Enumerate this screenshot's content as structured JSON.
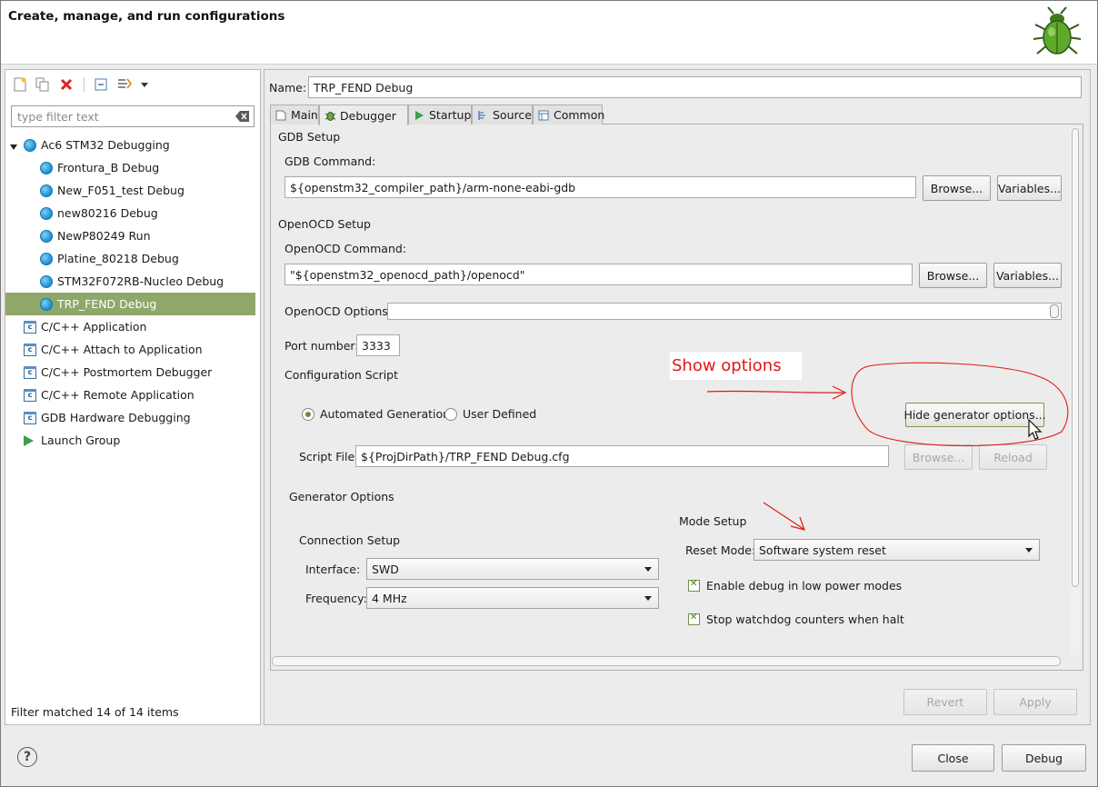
{
  "window": {
    "title": "Create, manage, and run configurations"
  },
  "sidebar": {
    "toolbar": [
      {
        "name": "new-config-icon"
      },
      {
        "name": "duplicate-icon"
      },
      {
        "name": "delete-icon"
      },
      {
        "name": "collapse-all-icon"
      },
      {
        "name": "filter-icon"
      },
      {
        "name": "dropdown-arrow-icon"
      }
    ],
    "filter_placeholder": "type filter text",
    "tree": [
      {
        "label": "Ac6 STM32 Debugging",
        "level": 0,
        "icon": "globe-icon",
        "expanded": true
      },
      {
        "label": "Frontura_B Debug",
        "level": 1,
        "icon": "globe-icon"
      },
      {
        "label": "New_F051_test Debug",
        "level": 1,
        "icon": "globe-icon"
      },
      {
        "label": "new80216 Debug",
        "level": 1,
        "icon": "globe-icon"
      },
      {
        "label": "NewP80249 Run",
        "level": 1,
        "icon": "globe-icon"
      },
      {
        "label": "Platine_80218 Debug",
        "level": 1,
        "icon": "globe-icon"
      },
      {
        "label": "STM32F072RB-Nucleo Debug",
        "level": 1,
        "icon": "globe-icon"
      },
      {
        "label": "TRP_FEND Debug",
        "level": 1,
        "icon": "globe-icon",
        "selected": true
      },
      {
        "label": "C/C++ Application",
        "level": 0,
        "icon": "c-app-icon"
      },
      {
        "label": "C/C++ Attach to Application",
        "level": 0,
        "icon": "c-app-icon"
      },
      {
        "label": "C/C++ Postmortem Debugger",
        "level": 0,
        "icon": "c-app-icon"
      },
      {
        "label": "C/C++ Remote Application",
        "level": 0,
        "icon": "c-app-icon"
      },
      {
        "label": "GDB Hardware Debugging",
        "level": 0,
        "icon": "c-app-icon"
      },
      {
        "label": "Launch Group",
        "level": 0,
        "icon": "launch-icon"
      }
    ],
    "status": "Filter matched 14 of 14 items"
  },
  "main": {
    "name_label": "Name:",
    "name_value": "TRP_FEND Debug",
    "tabs": [
      {
        "label": "Main",
        "icon": "main-tab-icon"
      },
      {
        "label": "Debugger",
        "icon": "debugger-tab-icon",
        "active": true
      },
      {
        "label": "Startup",
        "icon": "startup-tab-icon"
      },
      {
        "label": "Source",
        "icon": "source-tab-icon"
      },
      {
        "label": "Common",
        "icon": "common-tab-icon"
      }
    ],
    "gdb": {
      "section": "GDB Setup",
      "command_label": "GDB Command:",
      "command_value": "${openstm32_compiler_path}/arm-none-eabi-gdb",
      "browse": "Browse...",
      "variables": "Variables..."
    },
    "openocd": {
      "section": "OpenOCD Setup",
      "command_label": "OpenOCD Command:",
      "command_value": "\"${openstm32_openocd_path}/openocd\"",
      "browse": "Browse...",
      "variables": "Variables...",
      "options_label": "OpenOCD Options :",
      "options_value": "",
      "port_label": "Port number:",
      "port_value": "3333"
    },
    "config_script": {
      "section": "Configuration Script",
      "radio_auto": "Automated Generation",
      "radio_user": "User Defined",
      "selected": "Automated Generation",
      "hide_button": "Hide generator options...",
      "script_label": "Script File:",
      "script_value": "${ProjDirPath}/TRP_FEND Debug.cfg",
      "browse": "Browse...",
      "reload": "Reload"
    },
    "generator": {
      "section": "Generator Options",
      "connection": {
        "section": "Connection Setup",
        "interface_label": "Interface:",
        "interface_value": "SWD",
        "frequency_label": "Frequency:",
        "frequency_value": "4 MHz"
      },
      "mode": {
        "section": "Mode Setup",
        "reset_label": "Reset Mode:",
        "reset_value": "Software system reset",
        "check_low_power": "Enable debug in low power modes",
        "check_low_power_checked": true,
        "check_watchdog": "Stop watchdog counters when halt",
        "check_watchdog_checked": true
      }
    },
    "revert": "Revert",
    "apply": "Apply"
  },
  "annotation": {
    "text": "Show options",
    "color": "#e01818"
  },
  "footer": {
    "close": "Close",
    "debug": "Debug",
    "help_icon": "help-icon"
  },
  "colors": {
    "selection": "#8fa86a",
    "accent_green": "#6b8e3a"
  }
}
